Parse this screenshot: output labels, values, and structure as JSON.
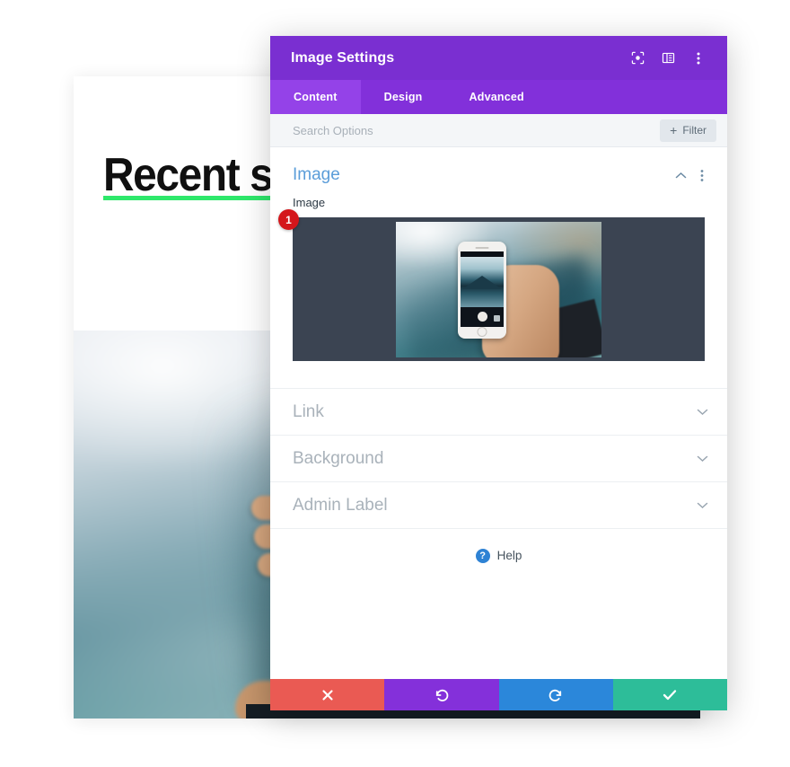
{
  "background_page": {
    "heading": "Recent sho",
    "underline_color": "#2ee86b",
    "photo_alt": "blurred mountain lake with hand"
  },
  "modal": {
    "title": "Image Settings",
    "titlebar_color": "#7a2fd1",
    "title_icons": [
      {
        "name": "focus-icon",
        "label": "Focus"
      },
      {
        "name": "layout-icon",
        "label": "Layout"
      },
      {
        "name": "more-vertical-icon",
        "label": "More"
      }
    ],
    "tabs": [
      {
        "label": "Content",
        "active": true
      },
      {
        "label": "Design",
        "active": false
      },
      {
        "label": "Advanced",
        "active": false
      }
    ],
    "search": {
      "value": "",
      "placeholder": "Search Options"
    },
    "filter_button": {
      "plus": "+",
      "label": "Filter"
    },
    "sections": {
      "image": {
        "title": "Image",
        "expanded": true,
        "toggle_icon": "chevron-up-icon",
        "menu_icon": "more-vertical-icon",
        "field_label": "Image",
        "badge": "1",
        "preview_background": "#3b4452"
      },
      "collapsed": [
        {
          "title": "Link",
          "toggle_icon": "chevron-down-icon"
        },
        {
          "title": "Background",
          "toggle_icon": "chevron-down-icon"
        },
        {
          "title": "Admin Label",
          "toggle_icon": "chevron-down-icon"
        }
      ]
    },
    "help": {
      "icon_glyph": "?",
      "label": "Help"
    },
    "footer_buttons": [
      {
        "name": "cancel-button",
        "icon": "close-icon",
        "color": "#ea5a53"
      },
      {
        "name": "undo-button",
        "icon": "undo-icon",
        "color": "#8430da"
      },
      {
        "name": "redo-button",
        "icon": "redo-icon",
        "color": "#2b87da"
      },
      {
        "name": "save-button",
        "icon": "check-icon",
        "color": "#2dbd99"
      }
    ]
  }
}
